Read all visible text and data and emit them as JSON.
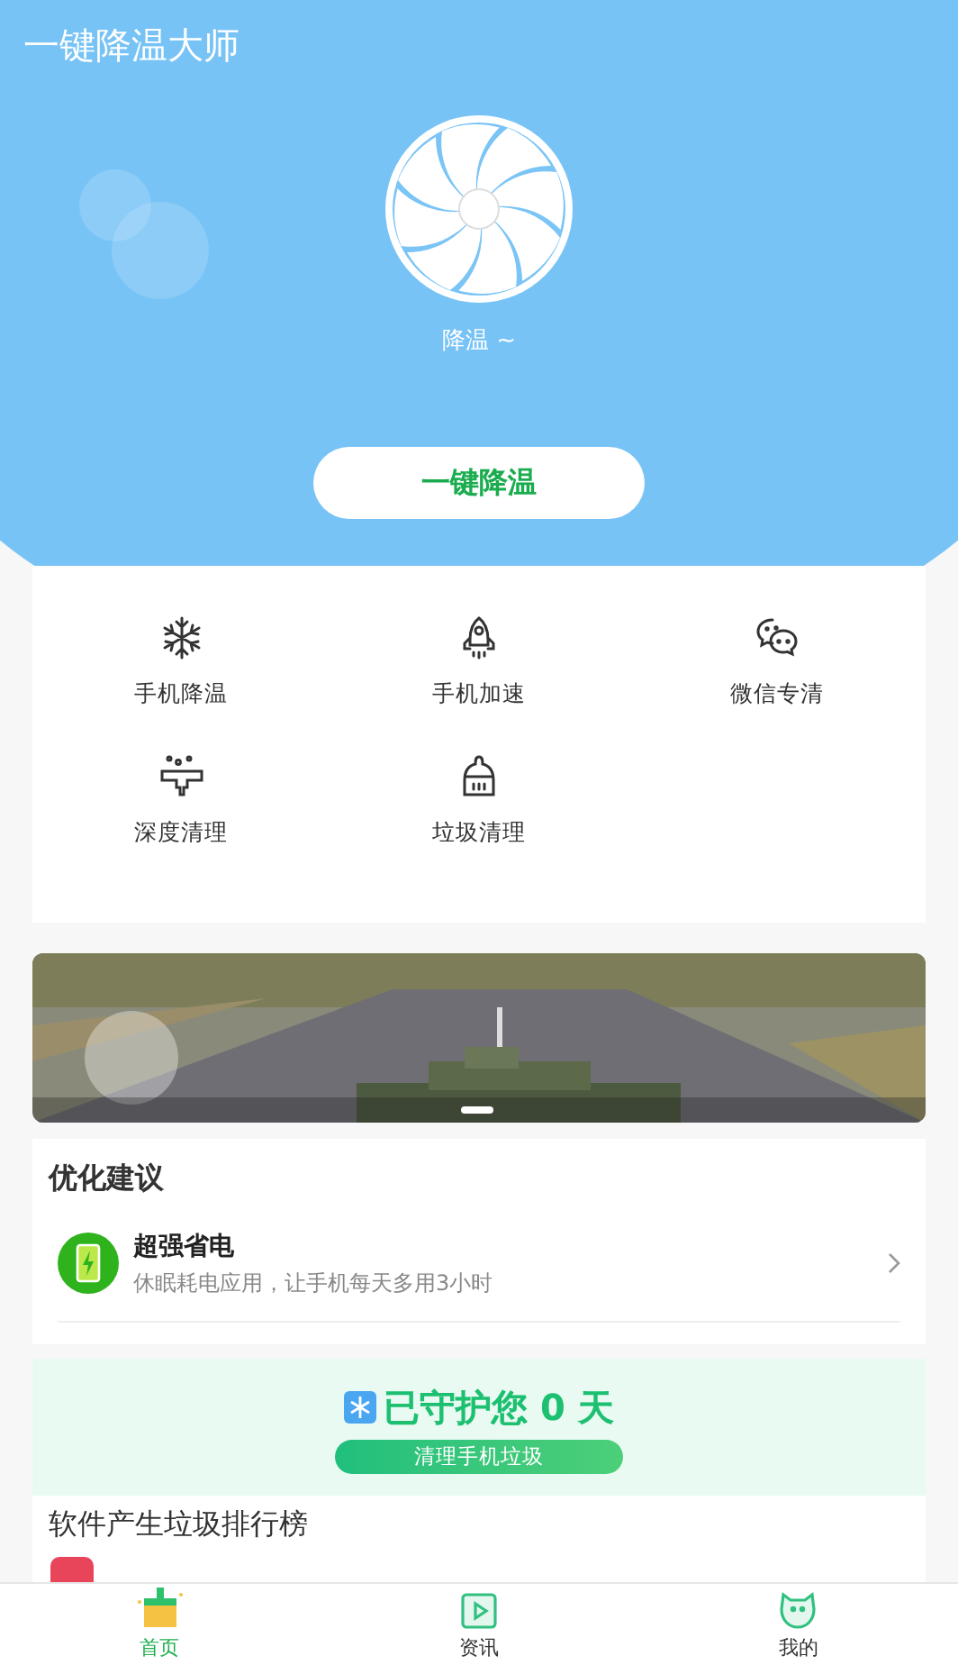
{
  "header": {
    "title": "一键降温大师",
    "fan_caption": "降温 ~",
    "action_button": "一键降温"
  },
  "tools": [
    {
      "label": "手机降温",
      "kind": "snowflake"
    },
    {
      "label": "手机加速",
      "kind": "rocket"
    },
    {
      "label": "微信专清",
      "kind": "chat"
    },
    {
      "label": "深度清理",
      "kind": "deep"
    },
    {
      "label": "垃圾清理",
      "kind": "broom"
    }
  ],
  "suggestions": {
    "title": "优化建议",
    "items": [
      {
        "title": "超强省电",
        "subtitle": "休眠耗电应用，让手机每天多用3小时"
      }
    ]
  },
  "protect": {
    "headline": "已守护您 0 天",
    "button": "清理手机垃圾"
  },
  "ranking": {
    "title": "软件产生垃圾排行榜"
  },
  "tab_bar": [
    {
      "label": "首页",
      "kind": "home",
      "selected": true
    },
    {
      "label": "资讯",
      "kind": "news",
      "selected": false
    },
    {
      "label": "我的",
      "kind": "me",
      "selected": false
    }
  ]
}
